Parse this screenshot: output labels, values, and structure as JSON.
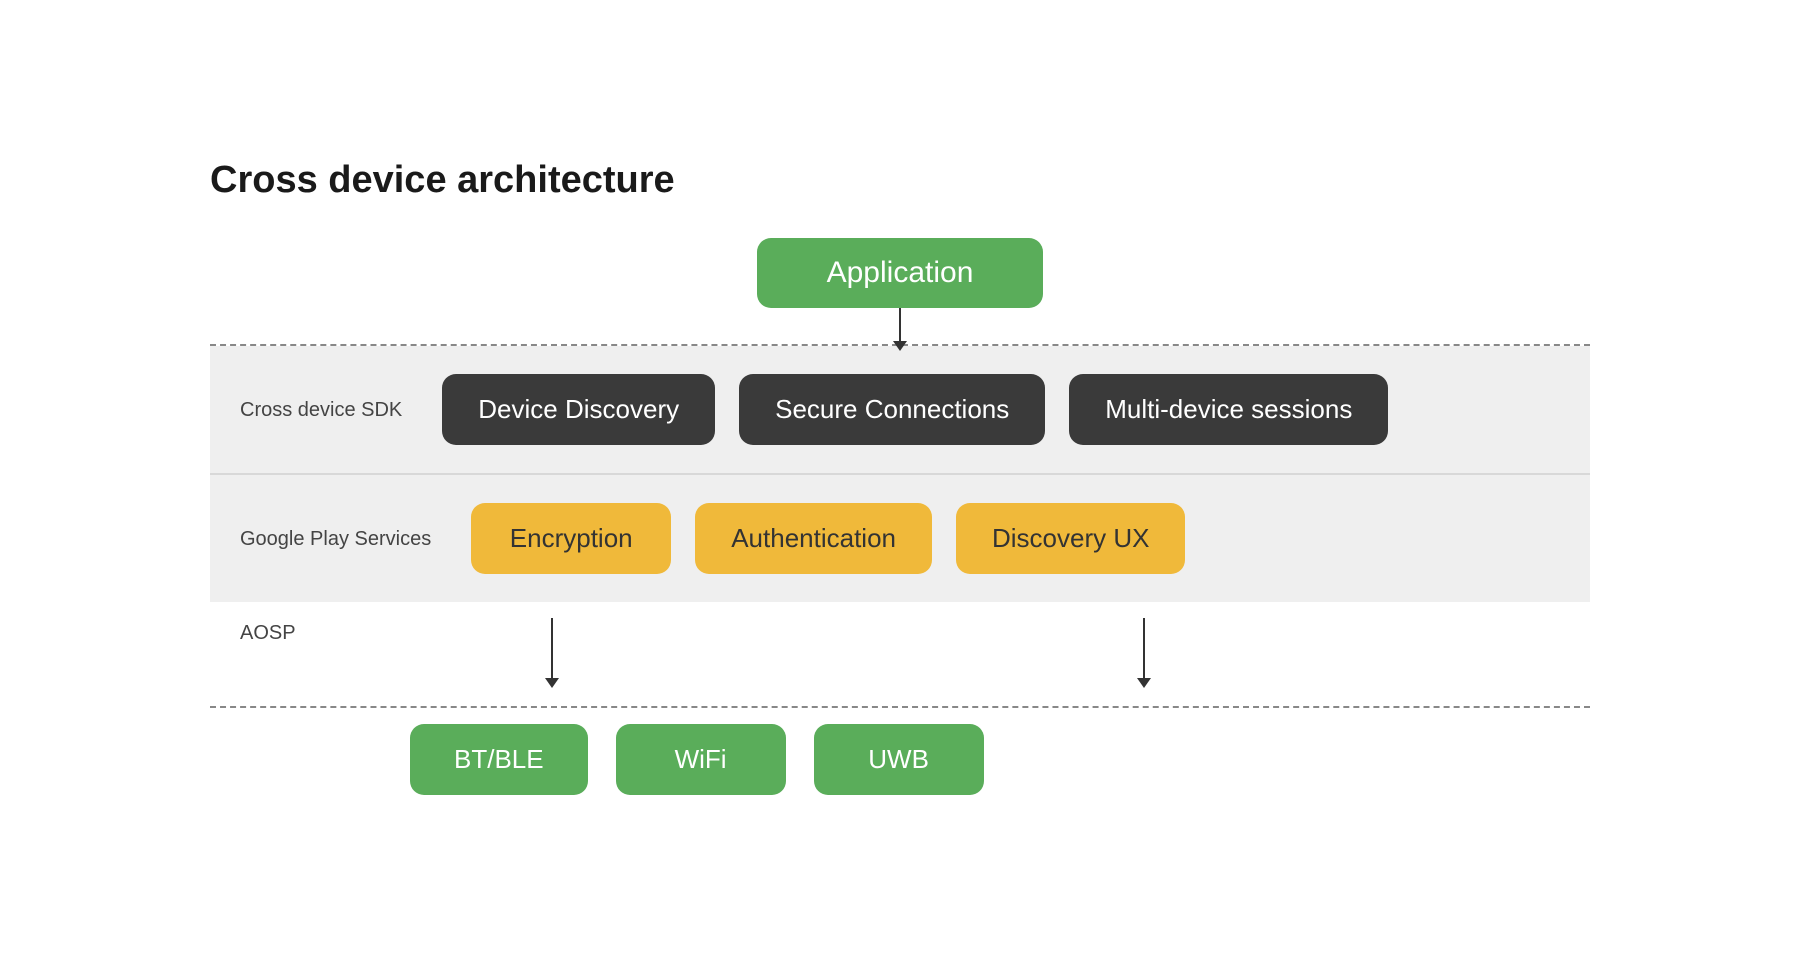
{
  "page": {
    "title": "Cross device architecture",
    "app_box": "Application",
    "sdk_label": "Cross device SDK",
    "sdk_boxes": [
      "Device Discovery",
      "Secure Connections",
      "Multi-device sessions"
    ],
    "play_label": "Google Play Services",
    "play_boxes": [
      "Encryption",
      "Authentication",
      "Discovery UX"
    ],
    "aosp_label": "AOSP",
    "bottom_boxes": [
      "BT/BLE",
      "WiFi",
      "UWB"
    ]
  }
}
